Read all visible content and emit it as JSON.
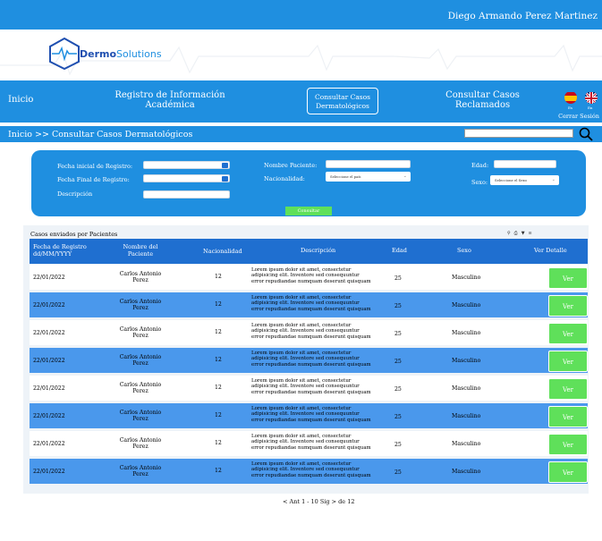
{
  "header": {
    "user_name": "Diego Armando Perez Martinez"
  },
  "brand": {
    "name_bold": "Dermo",
    "name_rest": "Solutions"
  },
  "nav": {
    "items": [
      {
        "label": "Inicio"
      },
      {
        "label": "Registro de Información\nAcadémica"
      },
      {
        "label": "Consultar Casos\nDermatológicos"
      },
      {
        "label": "Consultar Casos\nReclamados"
      }
    ],
    "lang_es": "Es",
    "lang_en": "En",
    "logout": "Cerrar Sesión"
  },
  "breadcrumb": {
    "text": "Inicio  >> Consultar Casos Dermatológicos"
  },
  "filters": {
    "fecha_inicial_label": "Fecha inicial de Registro:",
    "fecha_final_label": "Fecha Final de Registro:",
    "descripcion_label": "Descripción",
    "nombre_label": "Nombre Paciente:",
    "nacionalidad_label": "Nacionalidad:",
    "nacionalidad_placeholder": "Seleccione el país",
    "edad_label": "Edad:",
    "sexo_label": "Sexo:",
    "sexo_placeholder": "Seleccione el Sexo",
    "consultar_label": "Consultar"
  },
  "table": {
    "title": "Casos enviados por Pacientes",
    "columns": [
      "Fecha de Registro\ndd/MM/YYYY",
      "Nombre del\nPaciente",
      "Nacionalidad",
      "Descripción",
      "Edad",
      "Sexo",
      "Ver Detalle"
    ],
    "rows": [
      {
        "fecha": "22/01/2022",
        "nombre": "Carlos Antonio\nPerez",
        "nacionalidad": "12",
        "descripcion": "Lorem ipsum dolor sit amet, consectetur\nadipisicing elit. Inventore sed consequuntur\nerror repudiandae numquam deserunt quisquam",
        "edad": "25",
        "sexo": "Masculino",
        "ver": "Ver"
      },
      {
        "fecha": "22/01/2022",
        "nombre": "Carlos Antonio\nPerez",
        "nacionalidad": "12",
        "descripcion": "Lorem ipsum dolor sit amet, consectetur\nadipisicing elit. Inventore sed consequuntur\nerror repudiandae numquam deserunt quisquam",
        "edad": "25",
        "sexo": "Masculino",
        "ver": "Ver"
      },
      {
        "fecha": "22/01/2022",
        "nombre": "Carlos Antonio\nPerez",
        "nacionalidad": "12",
        "descripcion": "Lorem ipsum dolor sit amet, consectetur\nadipisicing elit. Inventore sed consequuntur\nerror repudiandae numquam deserunt quisquam",
        "edad": "25",
        "sexo": "Masculino",
        "ver": "Ver"
      },
      {
        "fecha": "22/01/2022",
        "nombre": "Carlos Antonio\nPerez",
        "nacionalidad": "12",
        "descripcion": "Lorem ipsum dolor sit amet, consectetur\nadipisicing elit. Inventore sed consequuntur\nerror repudiandae numquam deserunt quisquam",
        "edad": "25",
        "sexo": "Masculino",
        "ver": "Ver"
      },
      {
        "fecha": "22/01/2022",
        "nombre": "Carlos Antonio\nPerez",
        "nacionalidad": "12",
        "descripcion": "Lorem ipsum dolor sit amet, consectetur\nadipisicing elit. Inventore sed consequuntur\nerror repudiandae numquam deserunt quisquam",
        "edad": "25",
        "sexo": "Masculino",
        "ver": "Ver"
      },
      {
        "fecha": "22/01/2022",
        "nombre": "Carlos Antonio\nPerez",
        "nacionalidad": "12",
        "descripcion": "Lorem ipsum dolor sit amet, consectetur\nadipisicing elit. Inventore sed consequuntur\nerror repudiandae numquam deserunt quisquam",
        "edad": "25",
        "sexo": "Masculino",
        "ver": "Ver"
      },
      {
        "fecha": "22/01/2022",
        "nombre": "Carlos Antonio\nPerez",
        "nacionalidad": "12",
        "descripcion": "Lorem ipsum dolor sit amet, consectetur\nadipisicing elit. Inventore sed consequuntur\nerror repudiandae numquam deserunt quisquam",
        "edad": "25",
        "sexo": "Masculino",
        "ver": "Ver"
      },
      {
        "fecha": "22/01/2022",
        "nombre": "Carlos Antonio\nPerez",
        "nacionalidad": "12",
        "descripcion": "Lorem ipsum dolor sit amet, consectetur\nadipisicing elit. Inventore sed consequuntur\nerror repudiandae numquam deserunt quisquam",
        "edad": "25",
        "sexo": "Masculino",
        "ver": "Ver"
      }
    ]
  },
  "pagination": {
    "text": "< Ant 1 - 10 Sig > de 12"
  },
  "colors": {
    "primary": "#1f8fe0",
    "row_alt": "#4a98ec",
    "header_dark": "#1f6fd0",
    "accent_green": "#5fe05a",
    "brand_navy": "#1f4fb0"
  }
}
